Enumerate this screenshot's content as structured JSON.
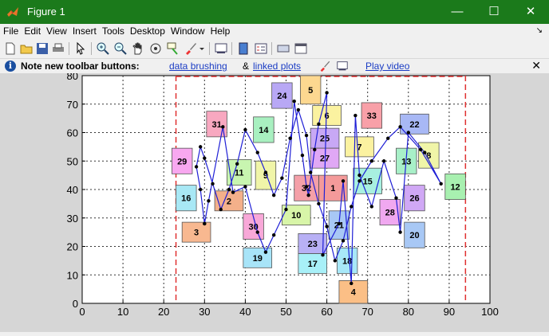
{
  "window": {
    "title": "Figure 1",
    "minimize": "—",
    "maximize": "☐",
    "close": "✕"
  },
  "menu": [
    "File",
    "Edit",
    "View",
    "Insert",
    "Tools",
    "Desktop",
    "Window",
    "Help"
  ],
  "menu_overflow": "↘",
  "toolbar_icons": [
    "new-figure-icon",
    "open-icon",
    "save-icon",
    "print-icon",
    "pointer-icon",
    "zoom-in-icon",
    "zoom-out-icon",
    "pan-icon",
    "rotate-3d-icon",
    "data-cursor-icon",
    "brush-icon",
    "link-plot-icon",
    "colorbar-icon",
    "legend-icon",
    "hide-tools-icon",
    "show-tools-icon"
  ],
  "infobar": {
    "note": "Note new toolbar buttons:",
    "link1": "data brushing",
    "amp": "&",
    "link2": "linked plots",
    "link3": "Play video",
    "close": "✕"
  },
  "colors": {
    "titlebar": "#1b7a1b",
    "path_line": "#1f1fd6",
    "boundary": "#e03030"
  },
  "chart_data": {
    "type": "scatter",
    "xlim": [
      0,
      100
    ],
    "ylim": [
      0,
      80
    ],
    "xticks": [
      0,
      10,
      20,
      30,
      40,
      50,
      60,
      70,
      80,
      90,
      100
    ],
    "yticks": [
      0,
      10,
      20,
      30,
      40,
      50,
      60,
      70,
      80
    ],
    "grid": true,
    "boundary": {
      "x0": 23,
      "x1": 94,
      "style": "dashed",
      "color": "#e03030"
    },
    "boxes": [
      {
        "id": "1",
        "cx": 61.5,
        "cy": 40.5,
        "w": 7,
        "h": 9,
        "color": "#f49a9a"
      },
      {
        "id": "2",
        "cx": 36,
        "cy": 36,
        "w": 7,
        "h": 7,
        "color": "#f4b08a"
      },
      {
        "id": "3",
        "cx": 28,
        "cy": 25,
        "w": 7,
        "h": 7,
        "color": "#f8b890"
      },
      {
        "id": "4",
        "cx": 66.5,
        "cy": 4,
        "w": 7,
        "h": 8,
        "color": "#fbbf86"
      },
      {
        "id": "5",
        "cx": 56,
        "cy": 75,
        "w": 5,
        "h": 10,
        "color": "#fdd890"
      },
      {
        "id": "6",
        "cx": 60,
        "cy": 66,
        "w": 7,
        "h": 7,
        "color": "#fbf2a0"
      },
      {
        "id": "7",
        "cx": 68,
        "cy": 55,
        "w": 7,
        "h": 7,
        "color": "#fbf2a0"
      },
      {
        "id": "8",
        "cx": 85,
        "cy": 52,
        "w": 5,
        "h": 9,
        "color": "#f0f5a8"
      },
      {
        "id": "9",
        "cx": 45,
        "cy": 45,
        "w": 5,
        "h": 10,
        "color": "#f0f5a8"
      },
      {
        "id": "10",
        "cx": 52.5,
        "cy": 31,
        "w": 7,
        "h": 7,
        "color": "#d8f5a8"
      },
      {
        "id": "11",
        "cx": 38.5,
        "cy": 46,
        "w": 6,
        "h": 9,
        "color": "#c8f5b0"
      },
      {
        "id": "12",
        "cx": 91.5,
        "cy": 41,
        "w": 5,
        "h": 9,
        "color": "#a8f0b0"
      },
      {
        "id": "13",
        "cx": 79.5,
        "cy": 50,
        "w": 5,
        "h": 9,
        "color": "#a8f0c8"
      },
      {
        "id": "14",
        "cx": 44.5,
        "cy": 61,
        "w": 5,
        "h": 9,
        "color": "#a8f0c0"
      },
      {
        "id": "15",
        "cx": 70,
        "cy": 43,
        "w": 7,
        "h": 9,
        "color": "#a8f0e0"
      },
      {
        "id": "16",
        "cx": 25.5,
        "cy": 37,
        "w": 5,
        "h": 9,
        "color": "#a8e8f5"
      },
      {
        "id": "17",
        "cx": 56.5,
        "cy": 14,
        "w": 7,
        "h": 7,
        "color": "#a8f0f8"
      },
      {
        "id": "18",
        "cx": 65,
        "cy": 15,
        "w": 5,
        "h": 9,
        "color": "#a8e8f8"
      },
      {
        "id": "19",
        "cx": 43,
        "cy": 16,
        "w": 7,
        "h": 7,
        "color": "#a8e4f8"
      },
      {
        "id": "20",
        "cx": 81.5,
        "cy": 24,
        "w": 5,
        "h": 9,
        "color": "#a8c8f5"
      },
      {
        "id": "21",
        "cx": 63,
        "cy": 27.5,
        "w": 5,
        "h": 10,
        "color": "#a8c8f5"
      },
      {
        "id": "22",
        "cx": 81.5,
        "cy": 63,
        "w": 7,
        "h": 7,
        "color": "#a8b8f5"
      },
      {
        "id": "23",
        "cx": 56.5,
        "cy": 21,
        "w": 7,
        "h": 7,
        "color": "#b8b0f5"
      },
      {
        "id": "24",
        "cx": 49,
        "cy": 73,
        "w": 5,
        "h": 9,
        "color": "#b8a8f5"
      },
      {
        "id": "25",
        "cx": 59.5,
        "cy": 58,
        "w": 7,
        "h": 7,
        "color": "#c8a8f5"
      },
      {
        "id": "26",
        "cx": 81.5,
        "cy": 37,
        "w": 5,
        "h": 9,
        "color": "#d0a8f5"
      },
      {
        "id": "27",
        "cx": 59.5,
        "cy": 51,
        "w": 7,
        "h": 7,
        "color": "#e0a8f5"
      },
      {
        "id": "28",
        "cx": 75.5,
        "cy": 32,
        "w": 5,
        "h": 9,
        "color": "#f0a8f0"
      },
      {
        "id": "29",
        "cx": 24.5,
        "cy": 50,
        "w": 5,
        "h": 9,
        "color": "#f8a8f0"
      },
      {
        "id": "30",
        "cx": 42,
        "cy": 27,
        "w": 5,
        "h": 9,
        "color": "#f8a8d8"
      },
      {
        "id": "31",
        "cx": 33,
        "cy": 63,
        "w": 5,
        "h": 9,
        "color": "#f8a8c0"
      },
      {
        "id": "32",
        "cx": 55,
        "cy": 40.5,
        "w": 6,
        "h": 9,
        "color": "#f4a0a8"
      },
      {
        "id": "33",
        "cx": 71,
        "cy": 66,
        "w": 5,
        "h": 9,
        "color": "#f8a0a8"
      }
    ],
    "path": {
      "x": [
        30,
        31,
        34.5,
        37,
        40,
        43,
        45,
        47,
        50,
        52,
        54,
        55,
        55.5,
        57,
        58,
        60,
        59,
        63,
        64,
        66,
        67,
        68,
        71,
        74,
        77,
        78,
        80,
        84,
        88,
        83,
        78,
        75,
        71,
        68,
        66,
        64,
        62,
        60,
        58,
        56,
        55,
        53,
        51,
        49,
        47,
        45,
        43,
        40,
        38,
        36,
        34,
        32,
        30,
        29,
        28,
        29,
        30
      ],
      "y": [
        28,
        36,
        62,
        39,
        41,
        25,
        18,
        24,
        33,
        71,
        52,
        41,
        38,
        54,
        63,
        74,
        17,
        28,
        43,
        7,
        66,
        45,
        34,
        50,
        37,
        25,
        60,
        53,
        42,
        54,
        62,
        58,
        50,
        43,
        34,
        22,
        15,
        27,
        35,
        46,
        59,
        68,
        58,
        44,
        38,
        46,
        53,
        61,
        49,
        40,
        33,
        42,
        51,
        55,
        48,
        40,
        28
      ]
    }
  }
}
